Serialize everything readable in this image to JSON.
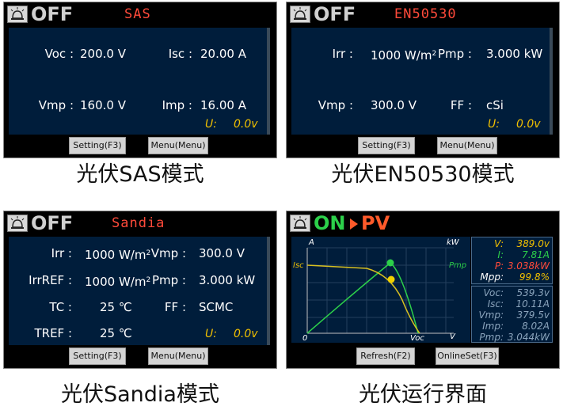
{
  "sas_panel": {
    "state": "OFF",
    "mode": "SAS",
    "fields": [
      {
        "label": "Voc :",
        "value": "200.0 V"
      },
      {
        "label": "Isc :",
        "value": "20.00 A"
      },
      {
        "label": "Vmp :",
        "value": "160.0 V"
      },
      {
        "label": "Imp :",
        "value": "16.00 A"
      }
    ],
    "u_label": "U:",
    "u_value": "0.0v",
    "buttons": [
      "Setting(F3)",
      "Menu(Menu)"
    ],
    "caption": "光伏SAS模式"
  },
  "en_panel": {
    "state": "OFF",
    "mode": "EN50530",
    "fields": [
      {
        "label": "Irr :",
        "value": "1000 W/m",
        "sup": "2"
      },
      {
        "label": "Pmp :",
        "value": "3.000 kW"
      },
      {
        "label": "Vmp :",
        "value": "300.0 V"
      },
      {
        "label": "FF :",
        "value": "cSi"
      }
    ],
    "u_label": "U:",
    "u_value": "0.0v",
    "buttons": [
      "Setting(F3)",
      "Menu(Menu)"
    ],
    "caption": "光伏EN50530模式"
  },
  "sandia_panel": {
    "state": "OFF",
    "mode": "Sandia",
    "fields": [
      {
        "label": "Irr :",
        "value": "1000 W/m",
        "sup": "2"
      },
      {
        "label": "Vmp :",
        "value": "300.0 V"
      },
      {
        "label": "IrrREF :",
        "value": "1000 W/m",
        "sup": "2"
      },
      {
        "label": "Pmp :",
        "value": "3.000 kW"
      },
      {
        "label": "TC :",
        "value": "25 ℃"
      },
      {
        "label": "FF :",
        "value": "SCMC"
      },
      {
        "label": "TREF :",
        "value": "25 ℃"
      }
    ],
    "u_label": "U:",
    "u_value": "0.0v",
    "buttons": [
      "Setting(F3)",
      "Menu(Menu)"
    ],
    "caption": "光伏Sandia模式"
  },
  "pv_panel": {
    "state": "ON",
    "mode": "PV",
    "axis": {
      "top_left": "A",
      "top_right": "kW",
      "bottom_origin": "0",
      "bottom_right": "V",
      "isc": "Isc",
      "pmp": "Pmp",
      "voc": "Voc"
    },
    "mpp": [
      {
        "label": "V:",
        "value": "389.0v",
        "color": "y"
      },
      {
        "label": "I:",
        "value": "7.81A",
        "color": "g"
      },
      {
        "label": "P:",
        "value": "3.038kW",
        "color": "r"
      },
      {
        "label": "Mpp:",
        "value": "99.8%",
        "color": "w"
      }
    ],
    "measured": [
      {
        "label": "Voc:",
        "value": "539.3v"
      },
      {
        "label": "Isc:",
        "value": "10.11A"
      },
      {
        "label": "Vmp:",
        "value": "379.5v"
      },
      {
        "label": "Imp:",
        "value": "8.02A"
      },
      {
        "label": "Pmp:",
        "value": "3.044kW"
      }
    ],
    "buttons": [
      "Refresh(F2)",
      "OnlineSet(F3)"
    ],
    "caption": "光伏运行界面"
  },
  "colors": {
    "screen_bg": "#001d3b",
    "mode_red": "#ff4a3a",
    "on_green": "#2cd04a",
    "pv_orange": "#ff5a2a",
    "u_yellow": "#f0c000"
  }
}
